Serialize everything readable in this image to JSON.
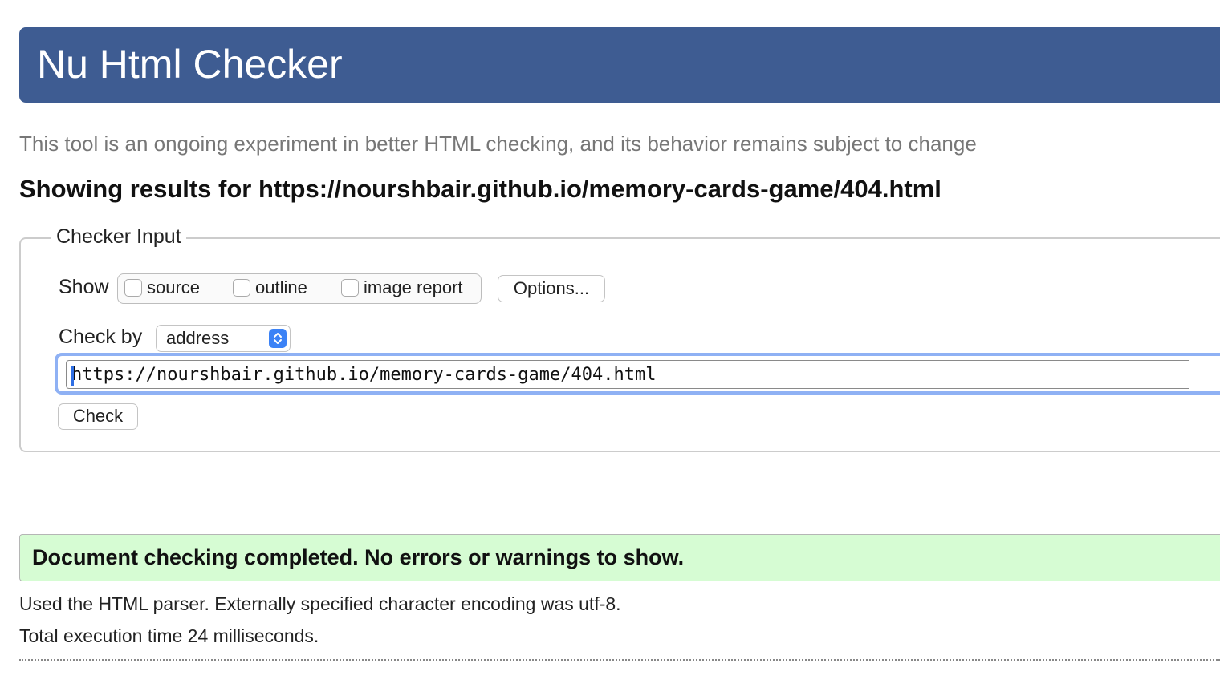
{
  "header": {
    "title": "Nu Html Checker"
  },
  "tagline": "This tool is an ongoing experiment in better HTML checking, and its behavior remains subject to change",
  "results_heading": "Showing results for https://nourshbair.github.io/memory-cards-game/404.html",
  "checker_input": {
    "legend": "Checker Input",
    "show_label": "Show",
    "show_options": [
      {
        "label": "source",
        "checked": false
      },
      {
        "label": "outline",
        "checked": false
      },
      {
        "label": "image report",
        "checked": false
      }
    ],
    "options_button": "Options...",
    "check_by_label": "Check by",
    "check_by_value": "address",
    "url_value": "https://nourshbair.github.io/memory-cards-game/404.html",
    "check_button": "Check"
  },
  "result": {
    "success_message": "Document checking completed. No errors or warnings to show.",
    "parser_info": "Used the HTML parser. Externally specified character encoding was utf-8.",
    "execution_time": "Total execution time 24 milliseconds."
  },
  "colors": {
    "header_bg": "#3e5c92",
    "success_bg": "#d6fcd3",
    "focus_ring": "#8fb1f4",
    "select_accent": "#3b82f6"
  }
}
